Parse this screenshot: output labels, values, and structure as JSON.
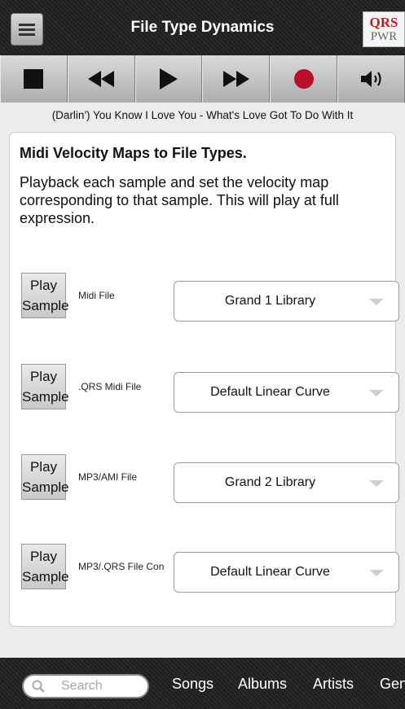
{
  "header": {
    "title": "File Type Dynamics"
  },
  "logo": {
    "line1": "QRS",
    "line2": "PWR"
  },
  "transport": {
    "buttons": [
      "stop-icon",
      "rewind-icon",
      "play-icon",
      "fast-forward-icon",
      "record-icon",
      "volume-icon"
    ],
    "record_color": "#b7102a"
  },
  "now_playing": "(Darlin') You Know I Love You - What's Love Got To Do With It",
  "card": {
    "heading": "Midi Velocity Maps to File Types.",
    "description": "Playback each sample and set the velocity map corresponding to that sample. This will play at full expression."
  },
  "rows": [
    {
      "play_label_1": "Play",
      "play_label_2": "Sample",
      "file_type": "Midi File",
      "selected": "Grand 1 Library"
    },
    {
      "play_label_1": "Play",
      "play_label_2": "Sample",
      "file_type": ".QRS Midi File",
      "selected": "Default Linear Curve"
    },
    {
      "play_label_1": "Play",
      "play_label_2": "Sample",
      "file_type": "MP3/AMI File",
      "selected": "Grand 2 Library"
    },
    {
      "play_label_1": "Play",
      "play_label_2": "Sample",
      "file_type": "MP3/.QRS File Con",
      "selected": "Default Linear Curve"
    }
  ],
  "bottom_nav": {
    "search_placeholder": "Search",
    "tabs": [
      "Songs",
      "Albums",
      "Artists",
      "Gen"
    ]
  }
}
